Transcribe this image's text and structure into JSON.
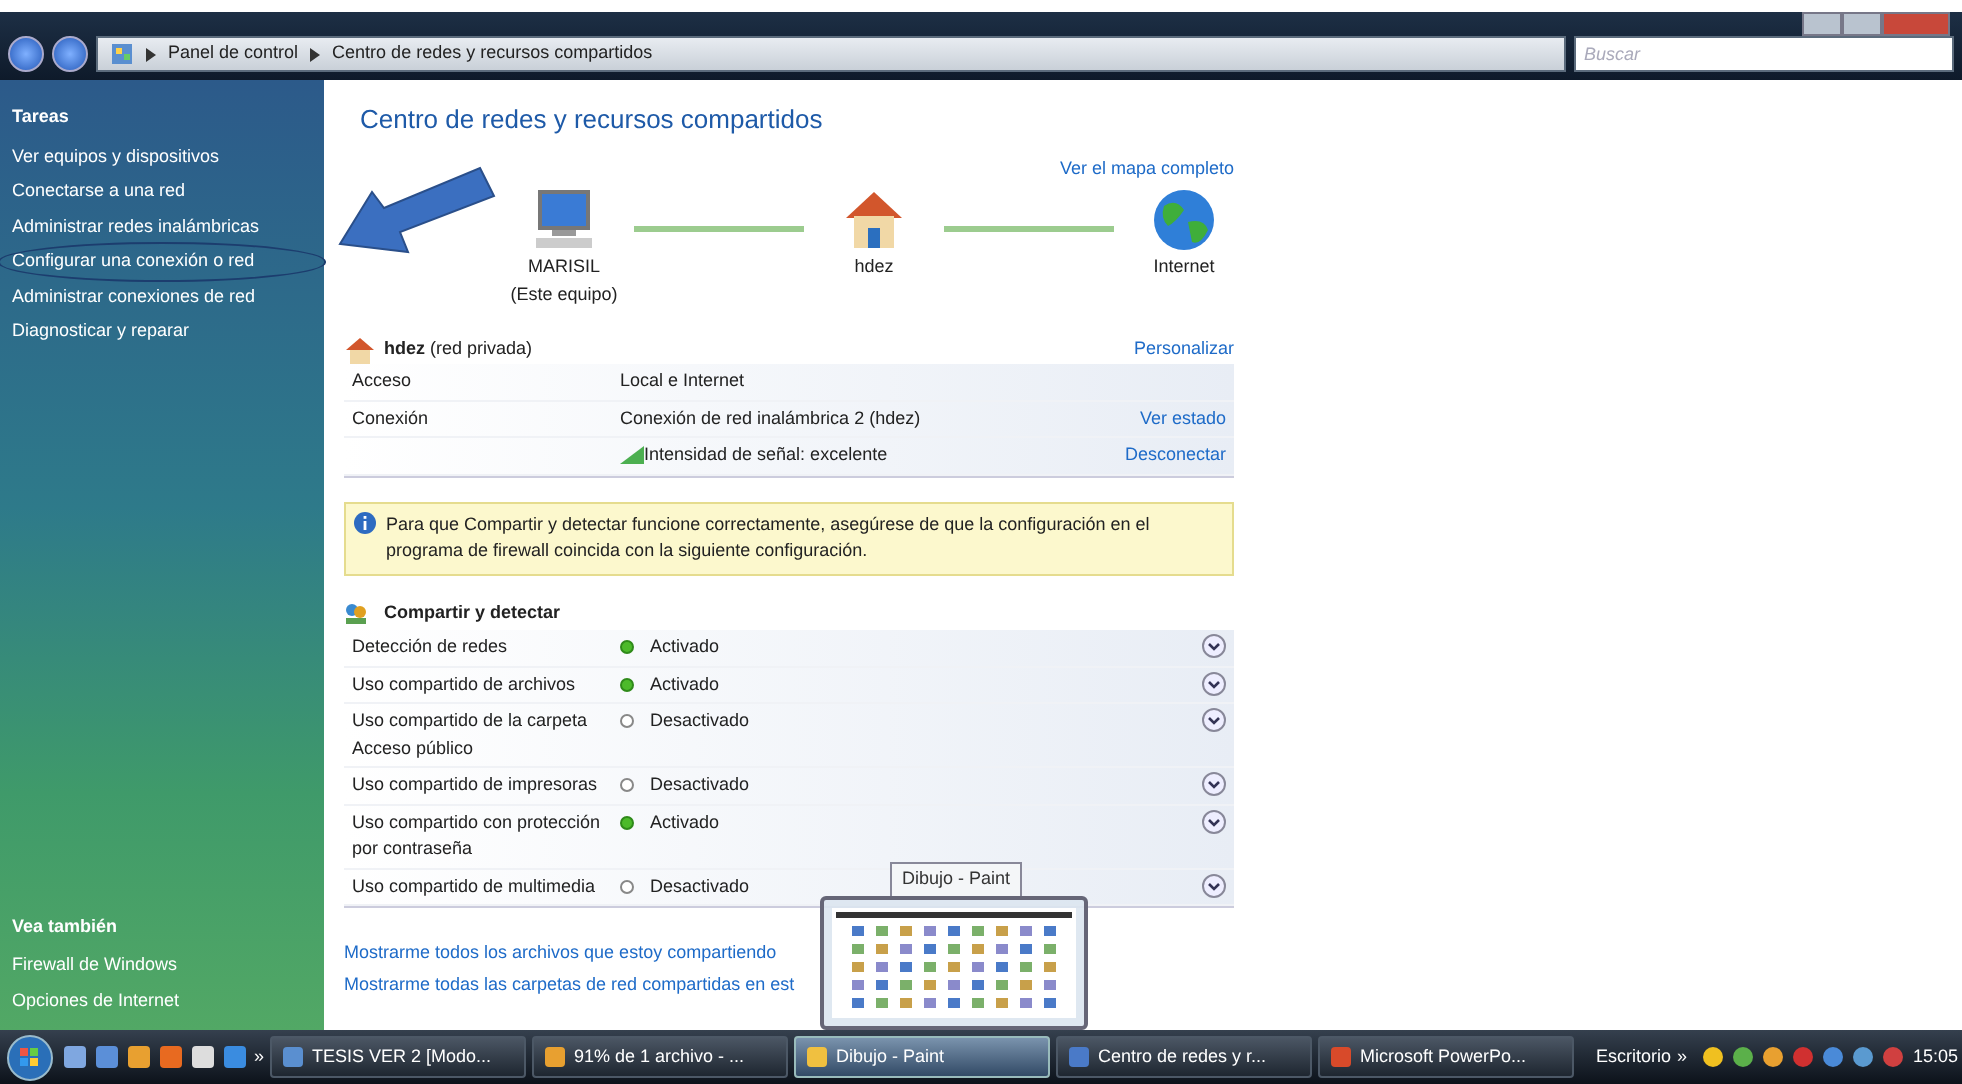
{
  "address_bar": {
    "path": [
      "Panel de control",
      "Centro de redes y recursos compartidos"
    ],
    "search_placeholder": "Buscar"
  },
  "sidebar": {
    "heading": "Tareas",
    "items": [
      {
        "label": "Ver equipos y dispositivos",
        "circled": false
      },
      {
        "label": "Conectarse a una red",
        "circled": false
      },
      {
        "label": "Administrar redes inalámbricas",
        "circled": false
      },
      {
        "label": "Configurar una conexión o red",
        "circled": true
      },
      {
        "label": "Administrar conexiones de red",
        "circled": false
      },
      {
        "label": "Diagnosticar y reparar",
        "circled": false
      }
    ],
    "see_also_heading": "Vea también",
    "see_also": [
      "Firewall de Windows",
      "Opciones de Internet"
    ]
  },
  "page": {
    "title": "Centro de redes y recursos compartidos",
    "map_link": "Ver el mapa completo",
    "map_nodes": [
      {
        "kind": "computer",
        "name": "MARISIL",
        "sub": "(Este equipo)"
      },
      {
        "kind": "house",
        "name": "hdez"
      },
      {
        "kind": "globe",
        "name": "Internet"
      }
    ]
  },
  "network": {
    "name": "hdez",
    "type": "(red privada)",
    "action": "Personalizar",
    "rows": [
      {
        "kind": "text",
        "label": "Acceso",
        "value": "Local e Internet"
      },
      {
        "kind": "text",
        "label": "Conexión",
        "value": "Conexión de red inalámbrica 2 (hdez)",
        "action": "Ver estado"
      },
      {
        "kind": "signal",
        "value": "Intensidad de señal: excelente",
        "action": "Desconectar"
      }
    ]
  },
  "notice": "Para que Compartir y detectar funcione correctamente, asegúrese de que la configuración en el programa de firewall coincida con la siguiente configuración.",
  "sharing": {
    "title": "Compartir y detectar",
    "rows": [
      {
        "label": "Detección de redes",
        "status": "Activado",
        "on": true
      },
      {
        "label": "Uso compartido de archivos",
        "status": "Activado",
        "on": true
      },
      {
        "label": "Uso compartido de la carpeta Acceso público",
        "status": "Desactivado",
        "on": false
      },
      {
        "label": "Uso compartido de impresoras",
        "status": "Desactivado",
        "on": false
      },
      {
        "label": "Uso compartido con protección por contraseña",
        "status": "Activado",
        "on": true
      },
      {
        "label": "Uso compartido de multimedia",
        "status": "Desactivado",
        "on": false
      }
    ]
  },
  "links": [
    "Mostrarme todos los archivos que estoy compartiendo",
    "Mostrarme todas las carpetas de red compartidas en est"
  ],
  "thumbnail": {
    "title": "Dibujo - Paint"
  },
  "taskbar": {
    "quick_overflow": "»",
    "buttons": [
      {
        "label": "TESIS VER 2 [Modo...",
        "selected": false
      },
      {
        "label": "91% de 1 archivo - ...",
        "selected": false
      },
      {
        "label": "Dibujo - Paint",
        "selected": true
      },
      {
        "label": "Centro de redes y r...",
        "selected": false
      },
      {
        "label": "Microsoft PowerPo...",
        "selected": false
      }
    ],
    "desktop": "Escritorio",
    "toolbar_overflow": "»",
    "clock": "15:05"
  }
}
